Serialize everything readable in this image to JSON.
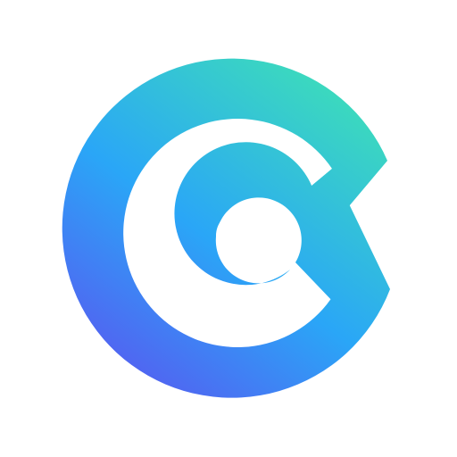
{
  "logo": {
    "icon": "coinex-style-c-logo",
    "colors": {
      "background": "#ffffff",
      "gradient_top": "#3fe3b3",
      "gradient_mid": "#2aa6f7",
      "gradient_bottom": "#5a55f0"
    }
  }
}
